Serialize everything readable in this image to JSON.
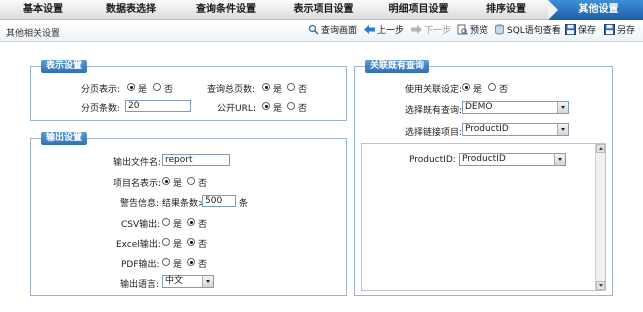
{
  "tabs": [
    {
      "label": "基本设置",
      "active": false
    },
    {
      "label": "数据表选择",
      "active": false
    },
    {
      "label": "查询条件设置",
      "active": false
    },
    {
      "label": "表示项目设置",
      "active": false
    },
    {
      "label": "明细项目设置",
      "active": false
    },
    {
      "label": "排序设置",
      "active": false
    },
    {
      "label": "其他设置",
      "active": true
    }
  ],
  "toolbar": {
    "section_title": "其他相关设置",
    "query_screen": "查询画面",
    "prev_step": "上一步",
    "next_step": "下一步",
    "preview": "预览",
    "sql_view": "SQL语句查看",
    "save": "保存",
    "save_as": "另存"
  },
  "display_settings": {
    "title": "表示设置",
    "paging_label": "分页表示:",
    "paging_yes": "是",
    "paging_no": "否",
    "paging_value": "yes",
    "total_pages_label": "查询总页数:",
    "total_yes": "是",
    "total_no": "否",
    "total_value": "yes",
    "page_size_label": "分页条数:",
    "page_size_value": "20",
    "public_url_label": "公开URL:",
    "url_yes": "是",
    "url_no": "否",
    "url_value": "yes"
  },
  "output_settings": {
    "title": "输出设置",
    "filename_label": "输出文件名:",
    "filename_value": "report",
    "item_name_label": "项目名表示:",
    "item_yes": "是",
    "item_no": "否",
    "item_value": "yes",
    "warning_label": "警告信息:",
    "warning_prefix": "结果条数>",
    "warning_value": "500",
    "warning_suffix": "条",
    "csv_label": "CSV输出:",
    "csv_yes": "是",
    "csv_no": "否",
    "csv_value": "no",
    "excel_label": "Excel输出:",
    "excel_yes": "是",
    "excel_no": "否",
    "excel_value": "no",
    "pdf_label": "PDF输出:",
    "pdf_yes": "是",
    "pdf_no": "否",
    "pdf_value": "no",
    "language_label": "输出语言:",
    "language_value": "中文"
  },
  "related_query": {
    "title": "关联既有查询",
    "use_label": "使用关联设定:",
    "use_yes": "是",
    "use_no": "否",
    "use_value": "yes",
    "select_query_label": "选择既有查询:",
    "select_query_value": "DEMO",
    "select_link_label": "选择链接项目:",
    "select_link_value": "ProductID",
    "mapping_label": "ProductID:",
    "mapping_value": "ProductID"
  }
}
